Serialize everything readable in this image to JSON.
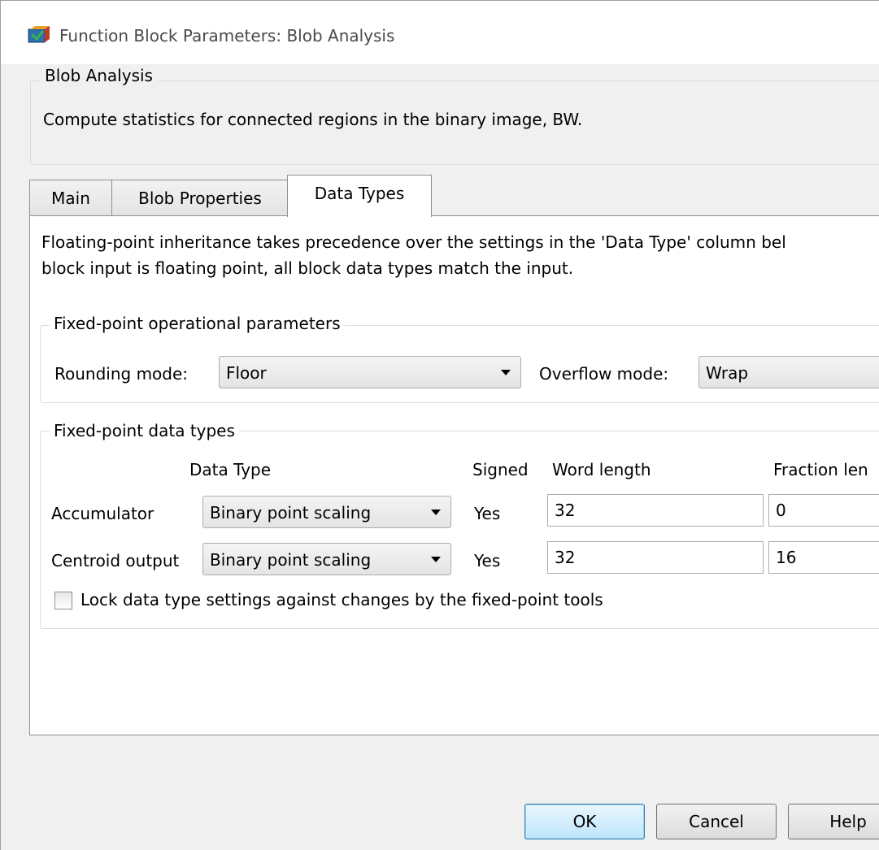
{
  "window": {
    "title": "Function Block Parameters: Blob Analysis"
  },
  "block": {
    "group_label": "Blob Analysis",
    "description": "Compute statistics for connected regions in the binary image, BW."
  },
  "tabs": [
    {
      "label": "Main",
      "active": false
    },
    {
      "label": "Blob Properties",
      "active": false
    },
    {
      "label": "Data Types",
      "active": true
    }
  ],
  "data_types": {
    "note_line1": "Floating-point inheritance takes precedence over the settings in the 'Data Type' column bel",
    "note_line2": "block input is floating point, all block data types match the input.",
    "operational": {
      "legend": "Fixed-point operational parameters",
      "rounding_label": "Rounding mode:",
      "rounding_value": "Floor",
      "overflow_label": "Overflow mode:",
      "overflow_value": "Wrap"
    },
    "fixed_types": {
      "legend": "Fixed-point data types",
      "headers": {
        "data_type": "Data Type",
        "signed": "Signed",
        "word_length": "Word length",
        "fraction_length": "Fraction len"
      },
      "rows": [
        {
          "name": "Accumulator",
          "data_type": "Binary point scaling",
          "signed": "Yes",
          "word_length": "32",
          "fraction_length": "0"
        },
        {
          "name": "Centroid output",
          "data_type": "Binary point scaling",
          "signed": "Yes",
          "word_length": "32",
          "fraction_length": "16"
        }
      ],
      "lock_label": "Lock data type settings against changes by the fixed-point tools",
      "lock_checked": false
    }
  },
  "buttons": {
    "ok": "OK",
    "cancel": "Cancel",
    "help": "Help"
  },
  "icons": {
    "app": "simulink-block-icon",
    "dropdown": "chevron-down-icon"
  }
}
